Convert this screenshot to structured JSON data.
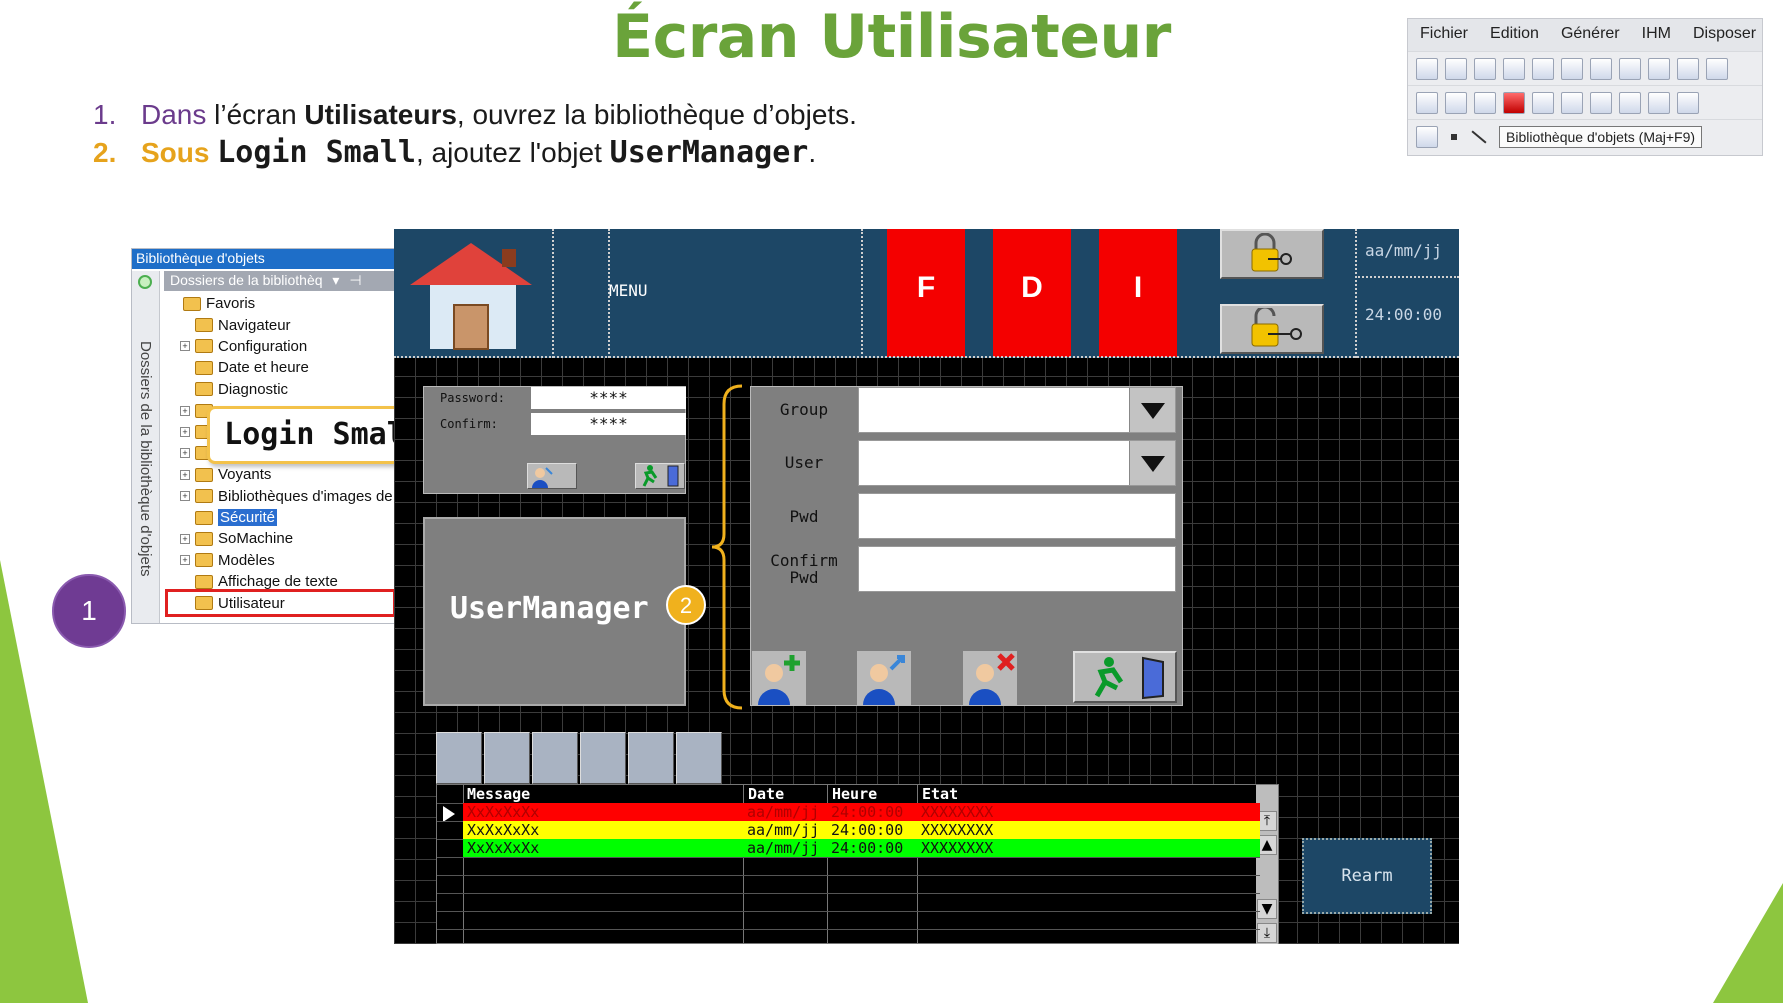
{
  "slide": {
    "title": "Écran Utilisateur",
    "step1": {
      "num": "1.",
      "w1": "Dans",
      "t1": " l’écran ",
      "b1": "Utilisateurs",
      "t2": ", ouvrez la bibliothèque d’objets."
    },
    "step2": {
      "num": "2.",
      "w1": "Sous",
      "t0": " ",
      "m1": "Login Small",
      "t1": ", ajoutez l'objet ",
      "m2": "UserManager",
      "t2": "."
    },
    "badge1": "1",
    "badge2": "2",
    "callout_login": "Login Small",
    "callout_usermanager": "UserManager"
  },
  "toolbar": {
    "menus": [
      "Fichier",
      "Edition",
      "Générer",
      "IHM",
      "Disposer"
    ],
    "tooltip": "Bibliothèque d'objets (Maj+F9)"
  },
  "library": {
    "title": "Bibliothèque d'objets",
    "folders_header": "Dossiers de la bibliothèq",
    "side_tab": "Dossiers de la bibliothèque d'objets",
    "items": [
      {
        "label": "Favoris",
        "expander": "",
        "level": 0
      },
      {
        "label": "Navigateur",
        "expander": "",
        "level": 1
      },
      {
        "label": "Configuration",
        "expander": "+",
        "level": 1
      },
      {
        "label": "Date et heure",
        "expander": "",
        "level": 1
      },
      {
        "label": "Diagnostic",
        "expander": "",
        "level": 1
      },
      {
        "label": "",
        "expander": "+",
        "level": 1
      },
      {
        "label": "",
        "expander": "+",
        "level": 1
      },
      {
        "label": "",
        "expander": "+",
        "level": 1
      },
      {
        "label": "Voyants",
        "expander": "+",
        "level": 1
      },
      {
        "label": "Bibliothèques d'images de",
        "expander": "+",
        "level": 1
      },
      {
        "label": "Sécurité",
        "expander": "",
        "level": 1,
        "selected": true
      },
      {
        "label": "SoMachine",
        "expander": "+",
        "level": 1
      },
      {
        "label": "Modèles",
        "expander": "+",
        "level": 1
      },
      {
        "label": "Affichage de texte",
        "expander": "",
        "level": 1
      },
      {
        "label": "Utilisateur",
        "expander": "",
        "level": 1,
        "highlighted": true
      }
    ]
  },
  "hmi": {
    "menu_label": "MENU",
    "buttons": {
      "f": "F",
      "d": "D",
      "i": "I"
    },
    "date": "aa/mm/jj",
    "time": "24:00:00",
    "login_small": {
      "password_label": "Password:",
      "password_value": "****",
      "confirm_label": "Confirm:",
      "confirm_value": "****"
    },
    "form": {
      "group_label": "Group",
      "user_label": "User",
      "pwd_label": "Pwd",
      "confirm_label_1": "Confirm",
      "confirm_label_2": "Pwd"
    },
    "alarm_table": {
      "headers": [
        "Message",
        "Date",
        "Heure",
        "Etat"
      ],
      "rows": [
        {
          "message": "XxXxXxXx",
          "date": "aa/mm/jj",
          "time": "24:00:00",
          "state": "XXXXXXXX",
          "color": "#ff0000"
        },
        {
          "message": "XxXxXxXx",
          "date": "aa/mm/jj",
          "time": "24:00:00",
          "state": "XXXXXXXX",
          "color": "#ffff00"
        },
        {
          "message": "XxXxXxXx",
          "date": "aa/mm/jj",
          "time": "24:00:00",
          "state": "XXXXXXXX",
          "color": "#00ff00"
        }
      ]
    },
    "rearm_label": "Rearm"
  },
  "colors": {
    "title": "#6aa33a",
    "accent_purple": "#6f3b93",
    "accent_orange": "#f0b11d",
    "hmi_header": "#1d4766",
    "hmi_red": "#f40000"
  }
}
